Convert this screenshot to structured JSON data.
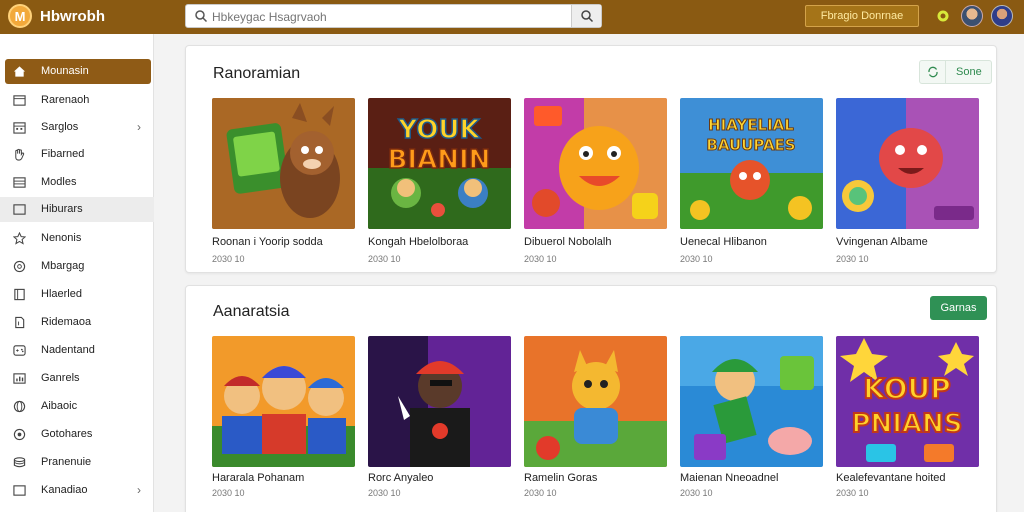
{
  "app": {
    "brand": "Hbwrobh",
    "logo_letter": "M"
  },
  "search": {
    "placeholder": "Hbkeygac Hsagrvaoh",
    "value": ""
  },
  "header": {
    "link_label": "Fbragio Donrnae"
  },
  "sidebar": {
    "items": [
      {
        "label": "Mounasin",
        "icon": "home-icon",
        "active": true
      },
      {
        "label": "Rarenaoh",
        "icon": "window-icon"
      },
      {
        "label": "Sarglos",
        "icon": "calendar-icon",
        "chevron": true
      },
      {
        "label": "Fibarned",
        "icon": "hand-icon"
      },
      {
        "label": "Modles",
        "icon": "list-icon"
      },
      {
        "label": "Hiburars",
        "icon": "folder-icon",
        "hover": true
      },
      {
        "label": "Nenonis",
        "icon": "star-icon"
      },
      {
        "label": "Mbargag",
        "icon": "circle-icon"
      },
      {
        "label": "Hlaerled",
        "icon": "book-icon"
      },
      {
        "label": "Ridemaoa",
        "icon": "document-icon"
      },
      {
        "label": "Nadentand",
        "icon": "gamepad-icon"
      },
      {
        "label": "Ganrels",
        "icon": "chart-icon"
      },
      {
        "label": "Aibaoic",
        "icon": "globe-icon"
      },
      {
        "label": "Gotohares",
        "icon": "gear-icon"
      },
      {
        "label": "Pranenuie",
        "icon": "stack-icon"
      },
      {
        "label": "Kanadiao",
        "icon": "folder-icon",
        "chevron": true
      }
    ]
  },
  "sections": [
    {
      "title": "Ranoramian",
      "button_label": "Sone",
      "games": [
        {
          "title": "Roonan i Yoorip sodda",
          "meta": "2030 10"
        },
        {
          "title": "Kongah Hbelolboraa",
          "meta": "2030 10"
        },
        {
          "title": "Dibuerol Nobolalh",
          "meta": "2030 10"
        },
        {
          "title": "Uenecal Hlibanon",
          "meta": "2030 10"
        },
        {
          "title": "Vvingenan Albame",
          "meta": "2030 10"
        }
      ]
    },
    {
      "title": "Aanaratsia",
      "button_label": "Garnas",
      "games": [
        {
          "title": "Hararala Pohanam",
          "meta": "2030 10"
        },
        {
          "title": "Rorc Anyaleo",
          "meta": "2030 10"
        },
        {
          "title": "Ramelin Goras",
          "meta": "2030 10"
        },
        {
          "title": "Maienan Nneoadnel",
          "meta": "2030 10"
        },
        {
          "title": "Kealefevantane hoited",
          "meta": "2030 10"
        }
      ]
    }
  ],
  "thumb_text": {
    "art2": [
      "YOUK",
      "BIANIN"
    ],
    "art4": [
      "HIAYELIAL",
      "BAUUPAES"
    ],
    "art10": [
      "KOUP",
      "PNIANS"
    ]
  },
  "colors": {
    "topbar": "#8a5a12",
    "active_item": "#8f5b16",
    "accent_green": "#2f9155"
  }
}
